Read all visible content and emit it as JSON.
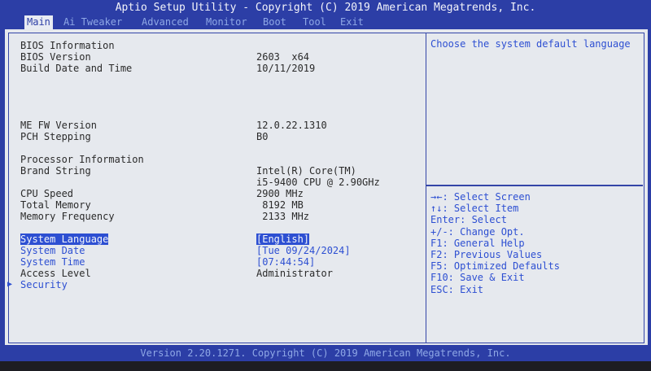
{
  "title": "Aptio Setup Utility - Copyright (C) 2019 American Megatrends, Inc.",
  "menu": [
    {
      "label": "Main",
      "active": true
    },
    {
      "label": "Ai Tweaker"
    },
    {
      "label": "Advanced"
    },
    {
      "label": "Monitor"
    },
    {
      "label": "Boot"
    },
    {
      "label": "Tool"
    },
    {
      "label": "Exit"
    }
  ],
  "info": {
    "bios_info": "BIOS Information",
    "bios_version_label": "BIOS Version",
    "bios_version": "2603  x64",
    "build_label": "Build Date and Time",
    "build_value": "10/11/2019",
    "me_fw_label": "ME FW Version",
    "me_fw_value": "12.0.22.1310",
    "pch_label": "PCH Stepping",
    "pch_value": "B0",
    "proc_info": "Processor Information",
    "brand_label": "Brand String",
    "brand_value_1": "Intel(R) Core(TM)",
    "brand_value_2": "i5-9400 CPU @ 2.90GHz",
    "cpu_speed_label": "CPU Speed",
    "cpu_speed_value": "2900 MHz",
    "total_mem_label": "Total Memory",
    "total_mem_value": " 8192 MB",
    "mem_freq_label": "Memory Frequency",
    "mem_freq_value": " 2133 MHz"
  },
  "settings": {
    "language_label": "System Language",
    "language_value": "[English]",
    "date_label": "System Date",
    "date_value": "[Tue 09/24/2024]",
    "time_label": "System Time",
    "time_value": "[07:44:54]",
    "access_label": "Access Level",
    "access_value": "Administrator",
    "security_label": "Security"
  },
  "help": {
    "text": "Choose the system default language"
  },
  "keys": [
    "→←: Select Screen",
    "↑↓: Select Item",
    "Enter: Select",
    "+/-: Change Opt.",
    "F1: General Help",
    "F2: Previous Values",
    "F5: Optimized Defaults",
    "F10: Save & Exit",
    "ESC: Exit"
  ],
  "footer": "Version 2.20.1271. Copyright (C) 2019 American Megatrends, Inc."
}
